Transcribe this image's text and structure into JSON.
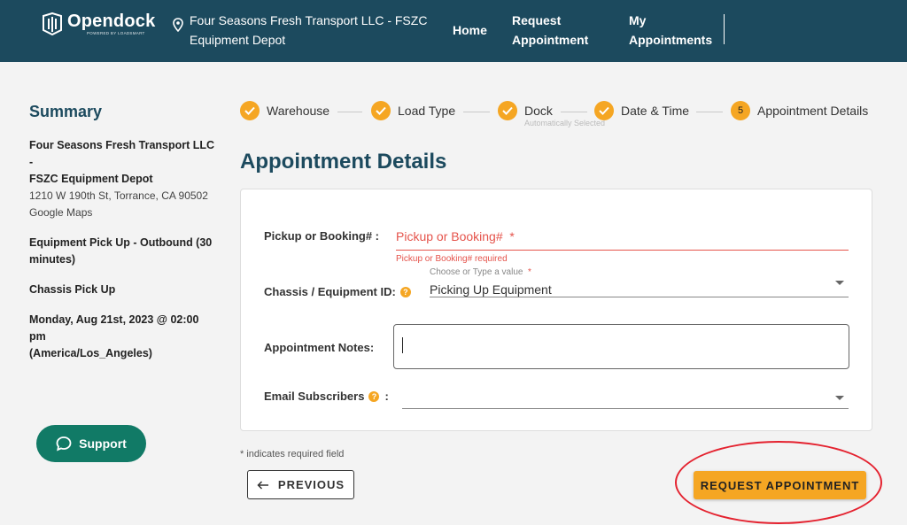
{
  "header": {
    "logo_name": "Opendock",
    "logo_sub": "POWERED BY LOADSMART",
    "warehouse_line1": "Four Seasons Fresh Transport LLC - FSZC",
    "warehouse_line2": "Equipment Depot",
    "nav": {
      "home": "Home",
      "request_line1": "Request",
      "request_line2": "Appointment",
      "my_line1": "My",
      "my_line2": "Appointments"
    }
  },
  "summary": {
    "title": "Summary",
    "warehouse_name_line1": "Four Seasons Fresh Transport LLC -",
    "warehouse_name_line2": "FSZC Equipment Depot",
    "address": "1210 W 190th St, Torrance, CA 90502",
    "maps_link": "Google Maps",
    "load_type_line1": "Equipment Pick Up - Outbound (30",
    "load_type_line2": "minutes)",
    "dock": "Chassis Pick Up",
    "datetime_line1": "Monday, Aug 21st, 2023 @ 02:00 pm",
    "datetime_line2": "(America/Los_Angeles)"
  },
  "support_label": "Support",
  "stepper": {
    "steps": [
      {
        "label": "Warehouse",
        "state": "done"
      },
      {
        "label": "Load Type",
        "state": "done"
      },
      {
        "label": "Dock",
        "state": "done"
      },
      {
        "label": "Date & Time",
        "state": "done"
      },
      {
        "label": "Appointment Details",
        "state": "current",
        "number": "5"
      }
    ],
    "dock_sub": "Automatically Selected"
  },
  "page_title": "Appointment Details",
  "form": {
    "pickup_label": "Pickup or Booking# :",
    "pickup_placeholder": "Pickup or Booking#",
    "pickup_required_star": "*",
    "pickup_error": "Pickup or Booking# required",
    "chassis_label": "Chassis / Equipment ID:",
    "chassis_float_label": "Choose or Type a value",
    "chassis_required_star": "*",
    "chassis_value": "Picking Up Equipment",
    "notes_label": "Appointment Notes:",
    "notes_value": "",
    "email_label": "Email Subscribers",
    "email_colon": ":",
    "help_glyph": "?"
  },
  "required_note": "* indicates required field",
  "buttons": {
    "previous": "PREVIOUS",
    "request": "REQUEST APPOINTMENT"
  },
  "colors": {
    "header_bg": "#1c4a5e",
    "accent": "#f5a623",
    "support_bg": "#117a66",
    "error": "#e5534b",
    "annotation": "#e4222f"
  }
}
